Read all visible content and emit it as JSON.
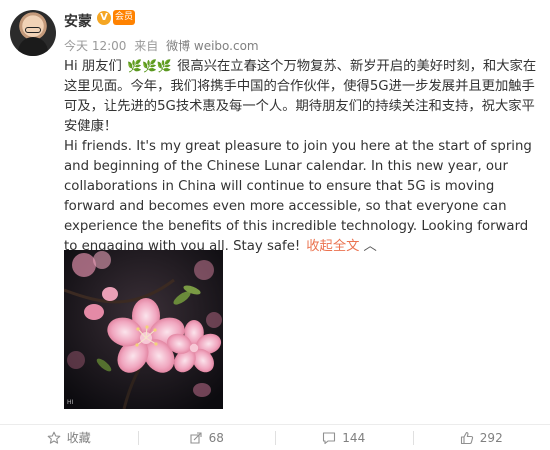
{
  "post": {
    "author_name": "安蒙",
    "verified_badge": "V",
    "vip_badge": "会员",
    "time": "今天 12:00",
    "source_prefix": "来自",
    "source": "微博 weibo.com",
    "greeting_zh": "Hi 朋友们",
    "text_zh": "很高兴在立春这个万物复苏、新岁开启的美好时刻，和大家在这里见面。今年，我们将携手中国的合作伙伴，使得5G进一步发展并且更加触手可及，让先进的5G技术惠及每一个人。期待朋友们的持续关注和支持，祝大家平安健康！",
    "text_en": "Hi friends. It's my great pleasure to join you here at the start of spring and beginning of the Chinese Lunar calendar. In this new year, our collaborations in China will continue to ensure that 5G is moving forward and becomes even more accessible, so that everyone can experience the benefits of this incredible technology. Looking forward to engaging with you all. Stay safe!",
    "collapse_label": "收起全文",
    "photo_watermark": "HI"
  },
  "actions": {
    "favorite_label": "收藏",
    "repost_count": "68",
    "comment_count": "144",
    "like_count": "292"
  },
  "colors": {
    "link_orange": "#eb7350",
    "muted_gray": "#999999",
    "text_dark": "#333333",
    "blossom_pink": "#e98aa7"
  }
}
